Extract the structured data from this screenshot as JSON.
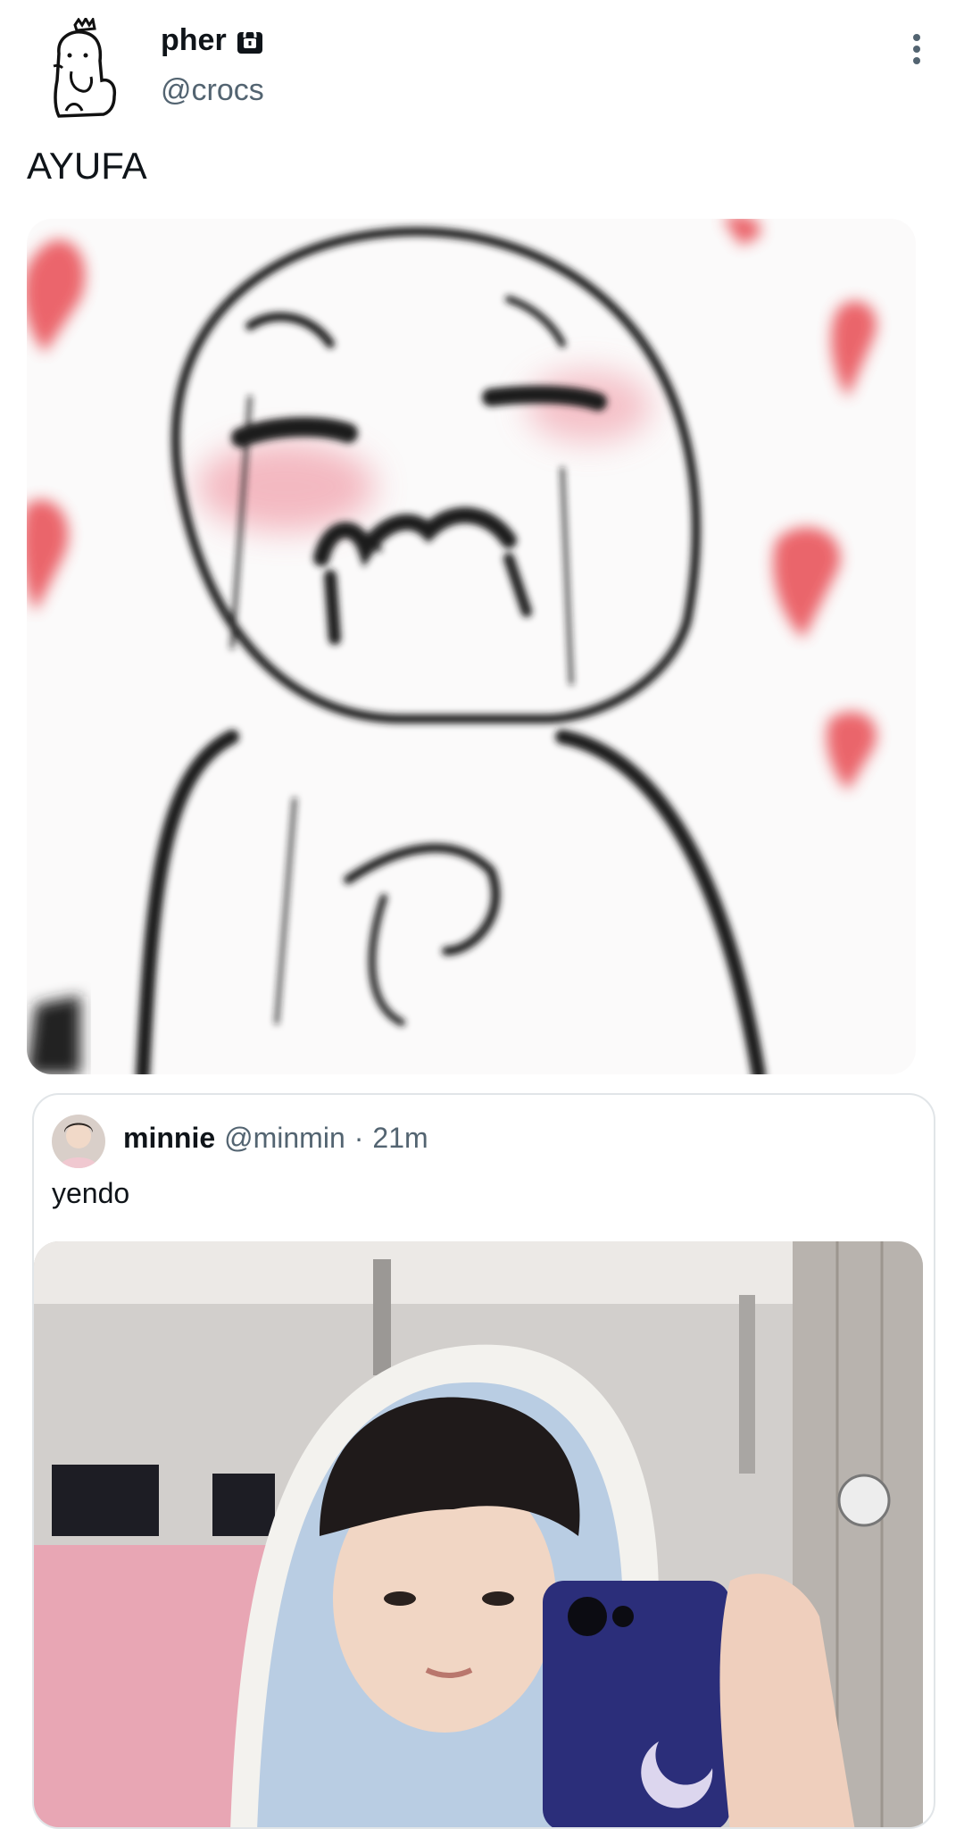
{
  "tweet": {
    "display_name": "pher",
    "handle": "@crocs",
    "text": "AYUFA",
    "protected_icon": "lock-icon",
    "more_icon": "more-vertical-icon"
  },
  "quoted_tweet": {
    "display_name": "minnie",
    "handle": "@minmin",
    "separator": "·",
    "time": "21m",
    "text": "yendo"
  },
  "colors": {
    "primary_text": "#0f1419",
    "secondary_text": "#536471",
    "border": "#e1e5e8",
    "heart_red": "#e9545c"
  }
}
